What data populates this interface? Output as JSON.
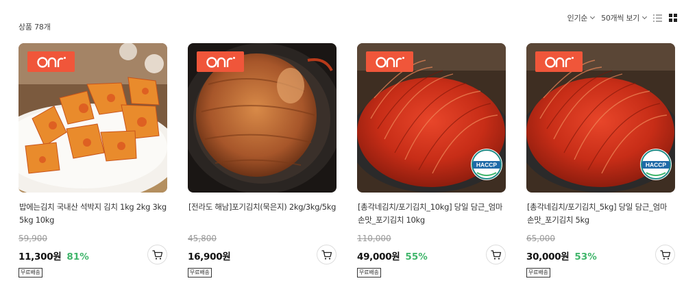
{
  "header": {
    "count_label": "상품 78개",
    "sort_label": "인기순",
    "per_page_label": "50개씩 보기",
    "view_list_icon": "list-view-icon",
    "view_grid_icon": "grid-view-icon"
  },
  "colors": {
    "badge": "#f0563a",
    "discount": "#3fb56a"
  },
  "products": [
    {
      "name": "밥에는김치 국내산 석박지 김치 1kg 2kg 3kg 5kg 10kg",
      "original_price": "59,900",
      "price": "11,300원",
      "discount": "81%",
      "shipping": "무료배송",
      "badge_icon": "brand-logo-badge",
      "haccp": false
    },
    {
      "name": "[전라도 해남]포기김치(묵은지) 2kg/3kg/5kg",
      "original_price": "45,800",
      "price": "16,900원",
      "discount": "",
      "shipping": "무료배송",
      "badge_icon": "brand-logo-badge",
      "haccp": false
    },
    {
      "name": "[총각네김치/포기김치_10kg] 당일 담근_엄마 손맛_포기김치 10kg",
      "original_price": "110,000",
      "price": "49,000원",
      "discount": "55%",
      "shipping": "무료배송",
      "badge_icon": "brand-logo-badge",
      "haccp": true,
      "haccp_text": "HACCP"
    },
    {
      "name": "[총각네김치/포기김치_5kg] 당일 담근_엄마 손맛_포기김치 5kg",
      "original_price": "65,000",
      "price": "30,000원",
      "discount": "53%",
      "shipping": "무료배송",
      "badge_icon": "brand-logo-badge",
      "haccp": true,
      "haccp_text": "HACCP"
    }
  ]
}
